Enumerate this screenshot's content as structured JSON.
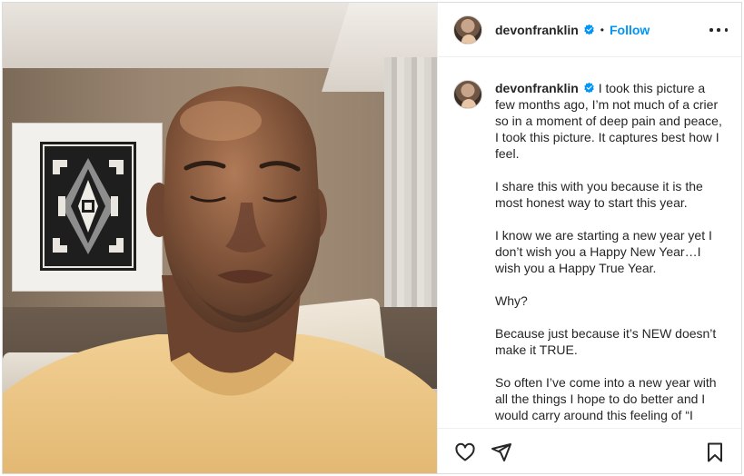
{
  "post": {
    "username": "devonfranklin",
    "separator": "•",
    "follow_label": "Follow",
    "caption": {
      "username": "devonfranklin",
      "paragraphs": [
        "I took this picture a few months ago, I’m not much of a crier so in a moment of deep pain and peace, I took this picture. It captures best how I feel.",
        "I share this with you because it is the most honest way to start this year.",
        "I know we are starting a new year yet I don’t wish you a Happy New Year…I wish you a Happy True Year.",
        "Why?",
        "Because just because it’s NEW doesn’t make it TRUE.",
        "So often I’ve come into a new year with all the things I hope to do better and I would carry around this feeling of “I"
      ]
    }
  },
  "icons": {
    "verified": "verified-badge-icon",
    "more": "more-options-icon",
    "like": "heart-icon",
    "share": "paper-plane-icon",
    "save": "bookmark-icon"
  },
  "colors": {
    "accent": "#0095f6",
    "text": "#262626",
    "border": "#dbdbdb"
  }
}
